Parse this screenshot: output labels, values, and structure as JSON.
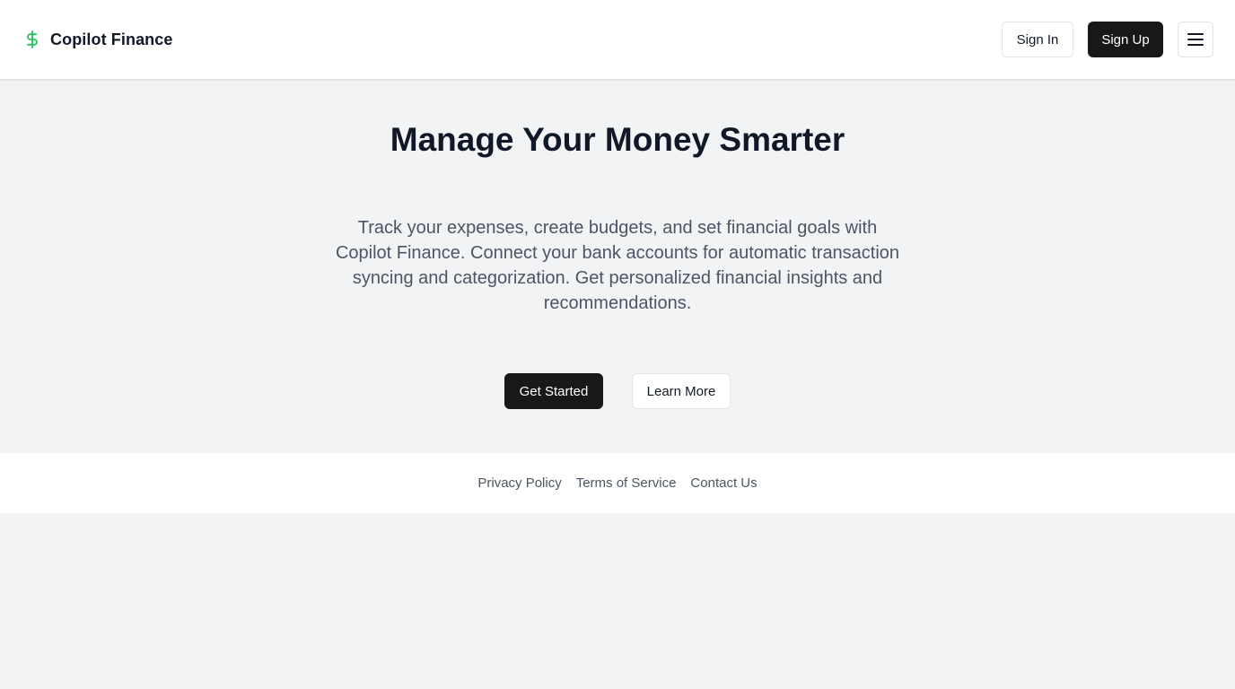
{
  "header": {
    "brand_name": "Copilot Finance",
    "brand_icon": "dollar-sign-icon",
    "sign_in_label": "Sign In",
    "sign_up_label": "Sign Up",
    "menu_icon": "menu-icon"
  },
  "hero": {
    "title": "Manage Your Money Smarter",
    "description": "Track your expenses, create budgets, and set financial goals with Copilot Finance. Connect your bank accounts for automatic transaction syncing and categorization. Get personalized financial insights and recommendations.",
    "primary_cta_label": "Get Started",
    "secondary_cta_label": "Learn More"
  },
  "footer": {
    "links": [
      {
        "label": "Privacy Policy"
      },
      {
        "label": "Terms of Service"
      },
      {
        "label": "Contact Us"
      }
    ]
  },
  "colors": {
    "brand_accent": "#22c55e",
    "dark_button": "#18181b",
    "page_background": "#f2f3f5"
  }
}
